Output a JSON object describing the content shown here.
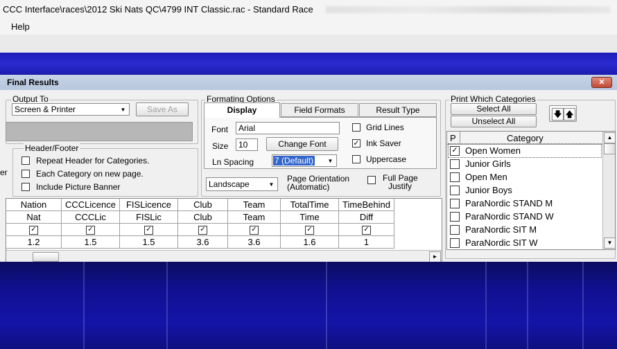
{
  "window": {
    "title": "CCC Interface\\races\\2012 Ski Nats QC\\4799 INT Classic.rac - Standard Race"
  },
  "menu": {
    "help": "Help"
  },
  "dialog": {
    "title": "Final Results",
    "close_label": "✕"
  },
  "output_to": {
    "label": "Output To",
    "selected": "Screen & Printer",
    "save_as": "Save As"
  },
  "header_footer": {
    "label": "Header/Footer",
    "left_fragment": "er",
    "options": [
      {
        "label": "Repeat Header for Categories.",
        "checked": false
      },
      {
        "label": "Each Category on new page.",
        "checked": false
      },
      {
        "label": "Include Picture Banner",
        "checked": false
      }
    ]
  },
  "formatting": {
    "label": "Formating Options",
    "tabs": [
      "Display",
      "Field Formats",
      "Result Type"
    ],
    "font_label": "Font",
    "font_value": "Arial",
    "size_label": "Size",
    "size_value": "10",
    "change_font": "Change Font",
    "ln_spacing_label": "Ln Spacing",
    "ln_spacing_value": "7 (Default)",
    "grid_lines": {
      "label": "Grid Lines",
      "checked": false
    },
    "ink_saver": {
      "label": "Ink Saver",
      "checked": true
    },
    "uppercase": {
      "label": "Uppercase",
      "checked": false
    },
    "orientation_value": "Landscape",
    "orientation_label": "Page Orientation",
    "orientation_sub": "(Automatic)",
    "full_page_label": "Full Page",
    "full_page_sub": "Justify",
    "full_page_checked": false
  },
  "columns_grid": {
    "headers": [
      "Nation",
      "CCCLicence",
      "FISLicence",
      "Club",
      "Team",
      "TotalTime",
      "TimeBehind"
    ],
    "codes": [
      "Nat",
      "CCCLic",
      "FISLic",
      "Club",
      "Team",
      "Time",
      "Diff"
    ],
    "checked": [
      true,
      true,
      true,
      true,
      true,
      true,
      true
    ],
    "widths": [
      "1.2",
      "1.5",
      "1.5",
      "3.6",
      "3.6",
      "1.6",
      "1"
    ]
  },
  "categories": {
    "label": "Print Which Categories",
    "select_all": "Select All",
    "unselect_all": "Unselect All",
    "down_icon": "down-arrow-icon",
    "up_icon": "up-arrow-icon",
    "header_p": "P",
    "header_category": "Category",
    "items": [
      {
        "name": "Open Women",
        "checked": true
      },
      {
        "name": "Junior Girls",
        "checked": false
      },
      {
        "name": "Open Men",
        "checked": false
      },
      {
        "name": "Junior Boys",
        "checked": false
      },
      {
        "name": "ParaNordic STAND M",
        "checked": false
      },
      {
        "name": "ParaNordic STAND W",
        "checked": false
      },
      {
        "name": "ParaNordic SIT M",
        "checked": false
      },
      {
        "name": "ParaNordic SIT W",
        "checked": false
      }
    ]
  },
  "colors": {
    "blue_band": "#2222c0",
    "dialog_title": "#bfcde3",
    "close_button": "#c8503c"
  }
}
